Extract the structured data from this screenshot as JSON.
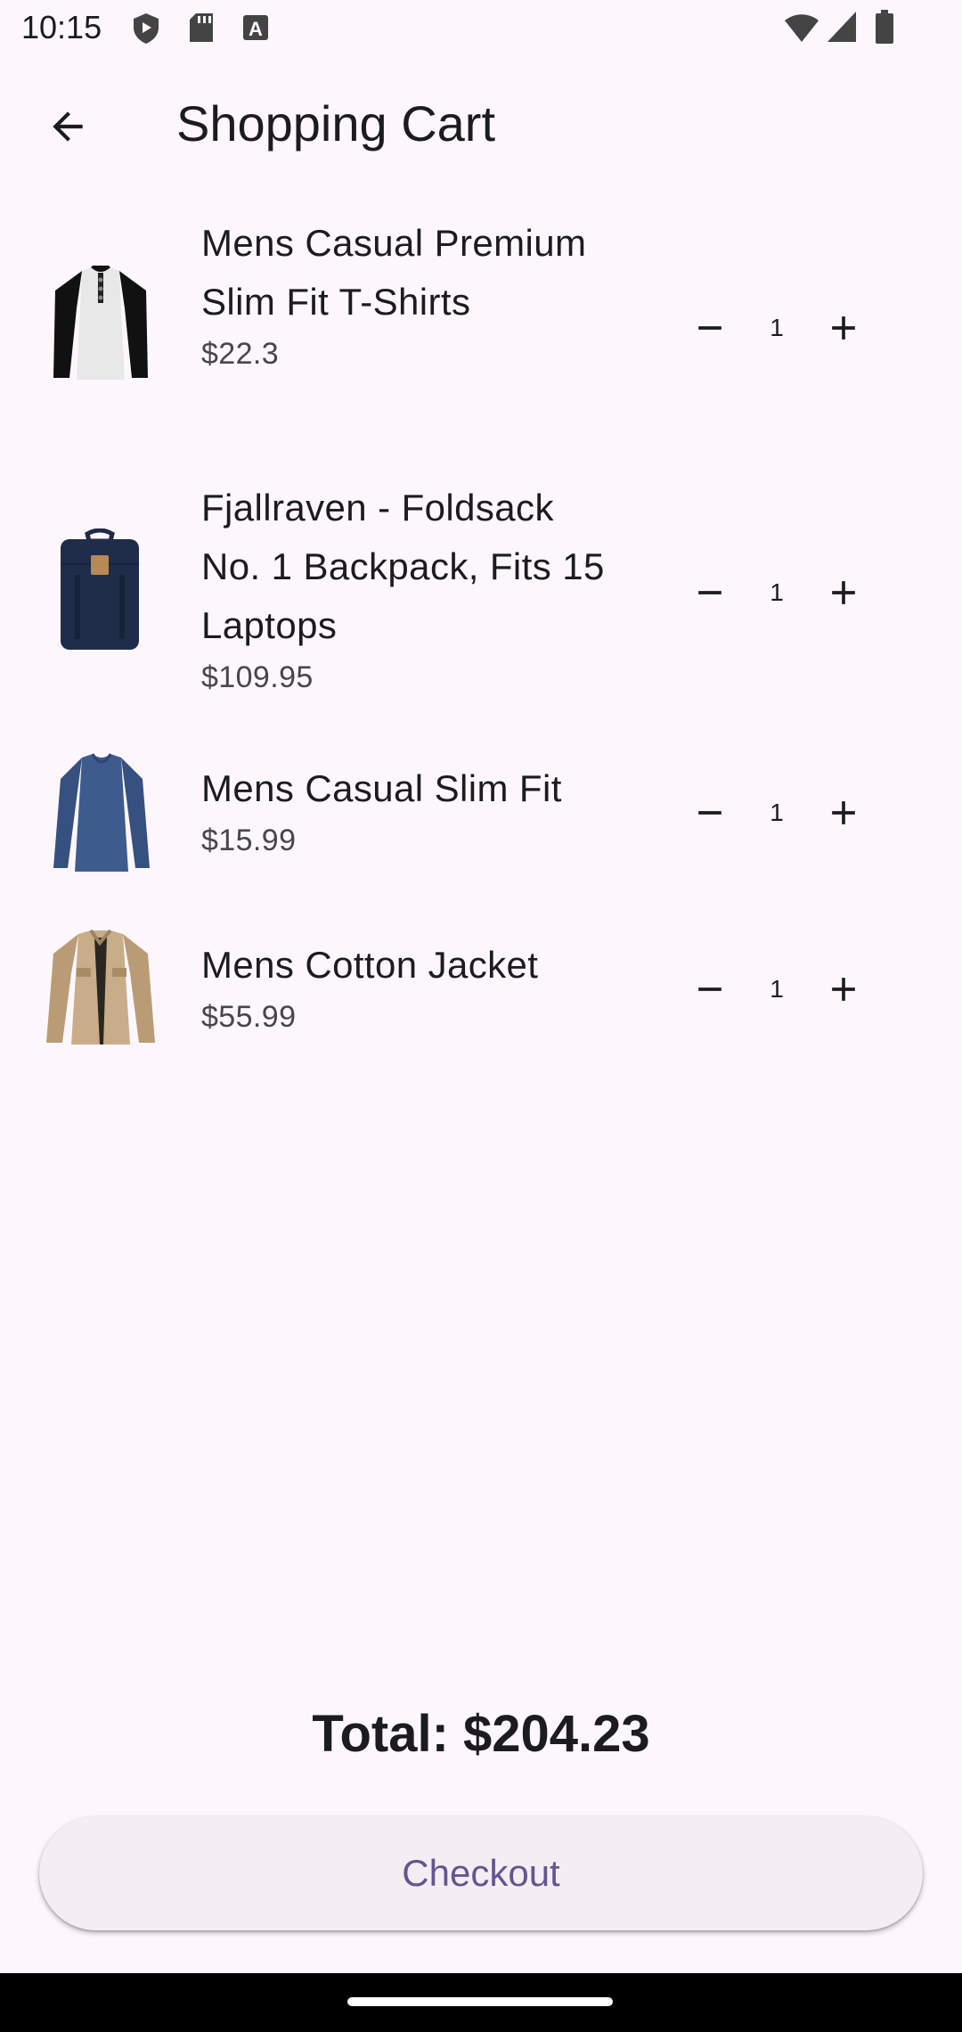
{
  "status_bar": {
    "time": "10:15",
    "icons_left": [
      "shield-icon",
      "sd-card-icon",
      "a-notification-icon"
    ],
    "icons_right": [
      "wifi-icon",
      "signal-icon",
      "battery-icon"
    ]
  },
  "app_bar": {
    "back_icon": "arrow-back-icon",
    "title": "Shopping Cart"
  },
  "cart": {
    "items": [
      {
        "name": "Mens Casual Premium Slim Fit T-Shirts",
        "price": "$22.3",
        "quantity": "1",
        "image": "raglan-henley-tshirt"
      },
      {
        "name": "Fjallraven - Foldsack No. 1 Backpack, Fits 15 Laptops",
        "price": "$109.95",
        "quantity": "1",
        "image": "navy-backpack"
      },
      {
        "name": "Mens Casual Slim Fit",
        "price": "$15.99",
        "quantity": "1",
        "image": "blue-long-sleeve-shirt"
      },
      {
        "name": "Mens Cotton Jacket",
        "price": "$55.99",
        "quantity": "1",
        "image": "khaki-cotton-jacket"
      }
    ]
  },
  "footer": {
    "total": "Total: $204.23",
    "checkout_label": "Checkout"
  },
  "colors": {
    "background": "#fdf7fd",
    "accent": "#65558f",
    "button_bg": "#f4eef4"
  }
}
